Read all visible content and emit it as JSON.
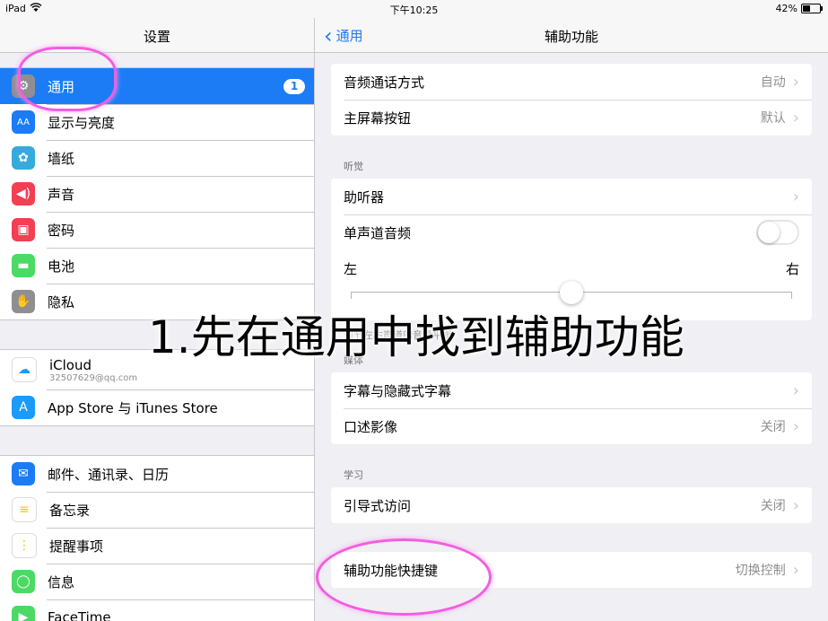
{
  "status": {
    "device": "iPad",
    "time": "下午10:25",
    "battery": "42%",
    "battery_level": 0.42
  },
  "left": {
    "title": "设置",
    "group1": [
      {
        "label": "通用",
        "icon": "gear-icon",
        "color": "#8e8e93",
        "badge": "1",
        "selected": true
      },
      {
        "label": "显示与亮度",
        "icon": "brightness-icon",
        "color": "#1b7cf5"
      },
      {
        "label": "墙纸",
        "icon": "wallpaper-icon",
        "color": "#35aadc"
      },
      {
        "label": "声音",
        "icon": "speaker-icon",
        "color": "#f23f52"
      },
      {
        "label": "密码",
        "icon": "lock-icon",
        "color": "#f23f52"
      },
      {
        "label": "电池",
        "icon": "battery-icon",
        "color": "#4cd964"
      },
      {
        "label": "隐私",
        "icon": "hand-icon",
        "color": "#8e8e93"
      }
    ],
    "group2": [
      {
        "label": "iCloud",
        "sub": "32507629@qq.com",
        "icon": "cloud-icon",
        "color": "#ffffff"
      },
      {
        "label": "App Store 与 iTunes Store",
        "icon": "appstore-icon",
        "color": "#1b9af7"
      }
    ],
    "group3": [
      {
        "label": "邮件、通讯录、日历",
        "icon": "mail-icon",
        "color": "#1b7cf5"
      },
      {
        "label": "备忘录",
        "icon": "notes-icon",
        "color": "#ffffff"
      },
      {
        "label": "提醒事项",
        "icon": "reminders-icon",
        "color": "#ffffff"
      },
      {
        "label": "信息",
        "icon": "messages-icon",
        "color": "#4cd964"
      },
      {
        "label": "FaceTime",
        "icon": "facetime-icon",
        "color": "#4cd964"
      }
    ]
  },
  "right": {
    "back": "通用",
    "title": "辅助功能",
    "top_rows": [
      {
        "label": "音频通话方式",
        "value": "自动"
      },
      {
        "label": "主屏幕按钮",
        "value": "默认"
      }
    ],
    "hearing_header": "听觉",
    "hearing_rows": [
      {
        "label": "助听器",
        "value": ""
      },
      {
        "label": "单声道音频",
        "toggle": "off"
      }
    ],
    "balance": {
      "left": "左",
      "right": "右",
      "position": 0.5
    },
    "balance_footnote": "调节左右声道的音量平衡",
    "media_header": "媒体",
    "media_rows": [
      {
        "label": "字幕与隐藏式字幕",
        "value": ""
      },
      {
        "label": "口述影像",
        "value": "关闭"
      }
    ],
    "learning_header": "学习",
    "learning_rows": [
      {
        "label": "引导式访问",
        "value": "关闭"
      }
    ],
    "shortcut_row": {
      "label": "辅助功能快捷键",
      "value": "切换控制"
    }
  },
  "overlay_text": "1.先在通用中找到辅助功能"
}
